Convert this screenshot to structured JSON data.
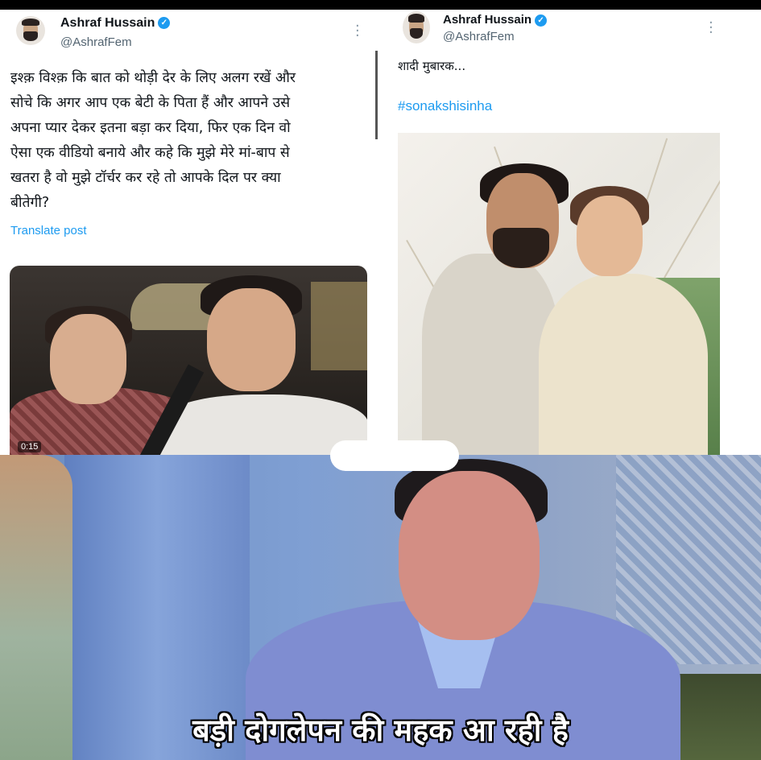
{
  "left_tweet": {
    "name": "Ashraf Hussain",
    "handle": "@AshrafFem",
    "text_lines": [
      "इश्क़ विश्क़ कि बात को थोड़ी देर के लिए अलग रखें और",
      "सोचे कि अगर आप एक बेटी के पिता हैं और आपने उसे",
      "अपना प्यार देकर इतना बड़ा कर दिया, फिर एक दिन वो",
      "ऐसा एक वीडियो बनाये और कहे कि मुझे मेरे मां-बाप से",
      "खतरा है वो मुझे टॉर्चर कर रहे तो आपके दिल पर क्या",
      "बीतेगी?"
    ],
    "translate_label": "Translate post",
    "video_time": "0:15"
  },
  "right_tweet": {
    "name": "Ashraf Hussain",
    "handle": "@AshrafFem",
    "text": "शादी मुबारक...",
    "hashtag": "#sonakshisinha"
  },
  "meme": {
    "caption": "बड़ी दोगलेपन की महक आ रही है"
  },
  "colors": {
    "link": "#1d9bf0",
    "verified": "#1d9bf0",
    "handle": "#536471"
  },
  "icons": {
    "verified": "verified-badge-icon",
    "more": "more-options-icon"
  }
}
